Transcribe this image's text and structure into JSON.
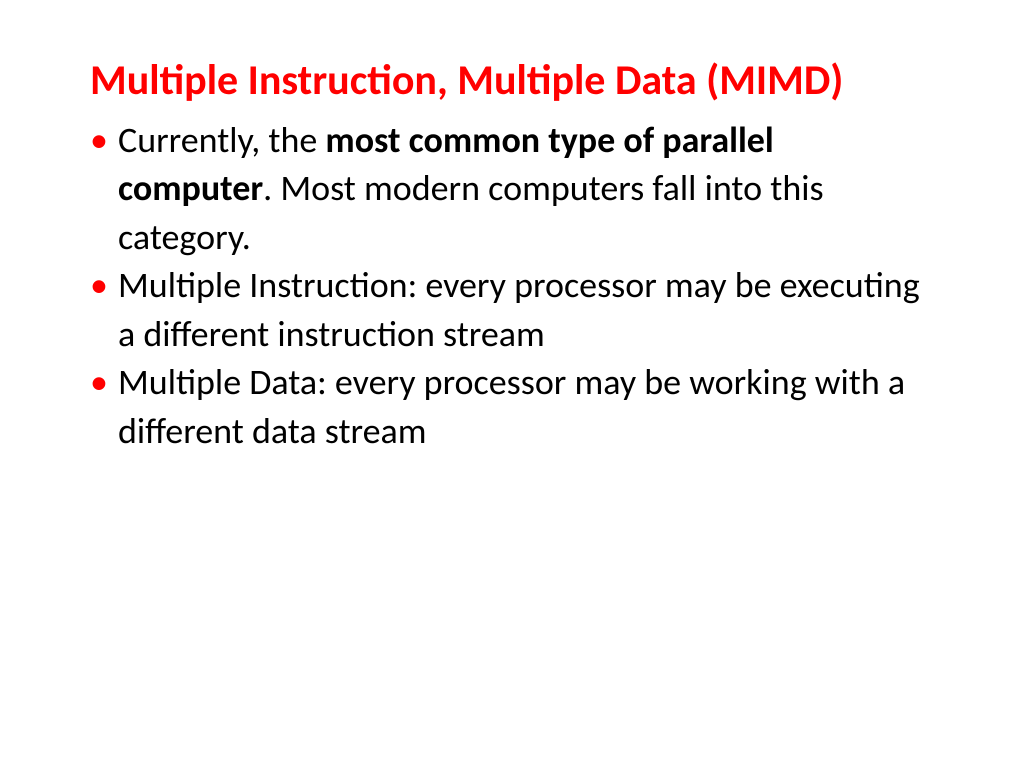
{
  "title": "Multiple Instruction, Multiple Data (MIMD)",
  "bullets": [
    {
      "pre": "Currently, the ",
      "bold": "most common type of parallel computer",
      "post": ". Most modern computers fall into this category."
    },
    {
      "text": "Multiple Instruction: every processor may be executing a different instruction stream"
    },
    {
      "text": "Multiple Data: every processor may be working with a different data stream"
    }
  ]
}
